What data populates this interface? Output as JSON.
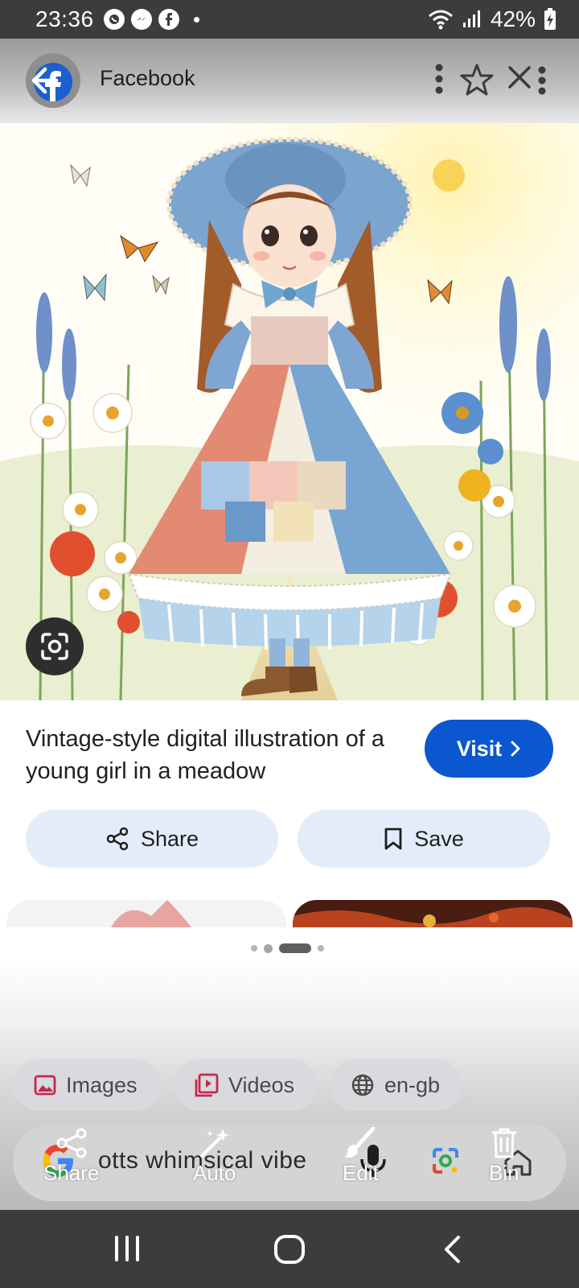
{
  "status_bar": {
    "time": "23:36",
    "battery": "42%",
    "notification_icons": [
      "whatsapp-icon",
      "messenger-icon",
      "facebook-icon"
    ]
  },
  "header": {
    "site_name": "Facebook"
  },
  "result": {
    "title": "Vintage-style digital illustration of a young girl in a meadow",
    "visit_label": "Visit",
    "share_label": "Share",
    "save_label": "Save"
  },
  "chips": [
    {
      "label": "Images",
      "icon": "image-icon"
    },
    {
      "label": "Videos",
      "icon": "video-icon"
    },
    {
      "label": "en-gb",
      "icon": "globe-icon"
    }
  ],
  "search": {
    "query": "otts whimsical  vibe"
  },
  "overlay_actions": [
    {
      "label": "Share",
      "icon": "share-icon"
    },
    {
      "label": "Auto",
      "icon": "magic-wand-icon"
    },
    {
      "label": "Edit",
      "icon": "brush-icon"
    },
    {
      "label": "Bin",
      "icon": "trash-icon"
    }
  ],
  "colors": {
    "accent": "#0b57d0",
    "pill_bg": "#e3ecfb",
    "system_bar": "#3c3c3c"
  }
}
